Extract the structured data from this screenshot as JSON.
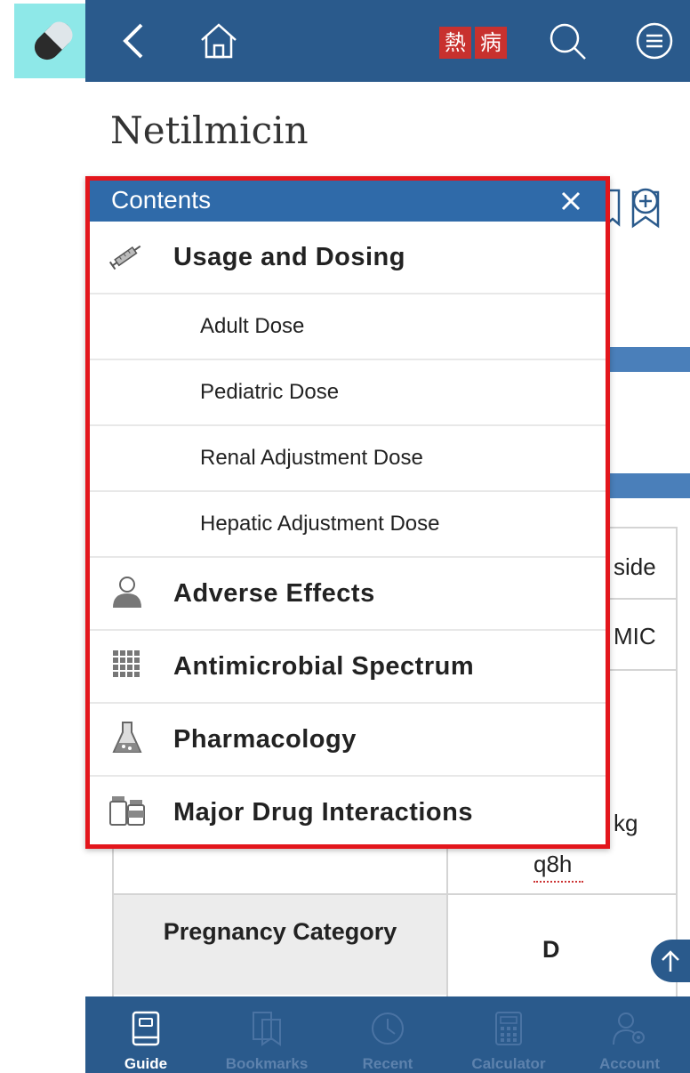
{
  "header": {
    "logo_chars": [
      "熱",
      "病"
    ]
  },
  "page": {
    "title": "Netilmicin",
    "partial_texts": {
      "side": "side",
      "mic": "MIC",
      "kg": "kg",
      "q8h": "q8h"
    },
    "pregnancy_label": "Pregnancy Category",
    "pregnancy_value": "D"
  },
  "contents": {
    "title": "Contents",
    "items": [
      {
        "type": "main",
        "label": "Usage and Dosing",
        "icon": "syringe-icon"
      },
      {
        "type": "sub",
        "label": "Adult Dose"
      },
      {
        "type": "sub",
        "label": "Pediatric Dose"
      },
      {
        "type": "sub",
        "label": "Renal Adjustment Dose"
      },
      {
        "type": "sub",
        "label": "Hepatic Adjustment Dose"
      },
      {
        "type": "main",
        "label": "Adverse Effects",
        "icon": "person-icon"
      },
      {
        "type": "main",
        "label": "Antimicrobial Spectrum",
        "icon": "grid-icon"
      },
      {
        "type": "main",
        "label": "Pharmacology",
        "icon": "flask-icon"
      },
      {
        "type": "main",
        "label": "Major Drug Interactions",
        "icon": "pill-bottles-icon"
      }
    ]
  },
  "bottom_nav": [
    {
      "label": "Guide",
      "icon": "book-icon",
      "active": true
    },
    {
      "label": "Bookmarks",
      "icon": "bookmarks-icon",
      "active": false
    },
    {
      "label": "Recent",
      "icon": "clock-icon",
      "active": false
    },
    {
      "label": "Calculator",
      "icon": "calculator-icon",
      "active": false
    },
    {
      "label": "Account",
      "icon": "account-icon",
      "active": false
    }
  ],
  "colors": {
    "topbar": "#2a5a8c",
    "contents_header": "#2f6aa9",
    "highlight_border": "#e3161c",
    "app_icon_bg": "#8ee8e8",
    "logo_red": "#c8312e"
  }
}
